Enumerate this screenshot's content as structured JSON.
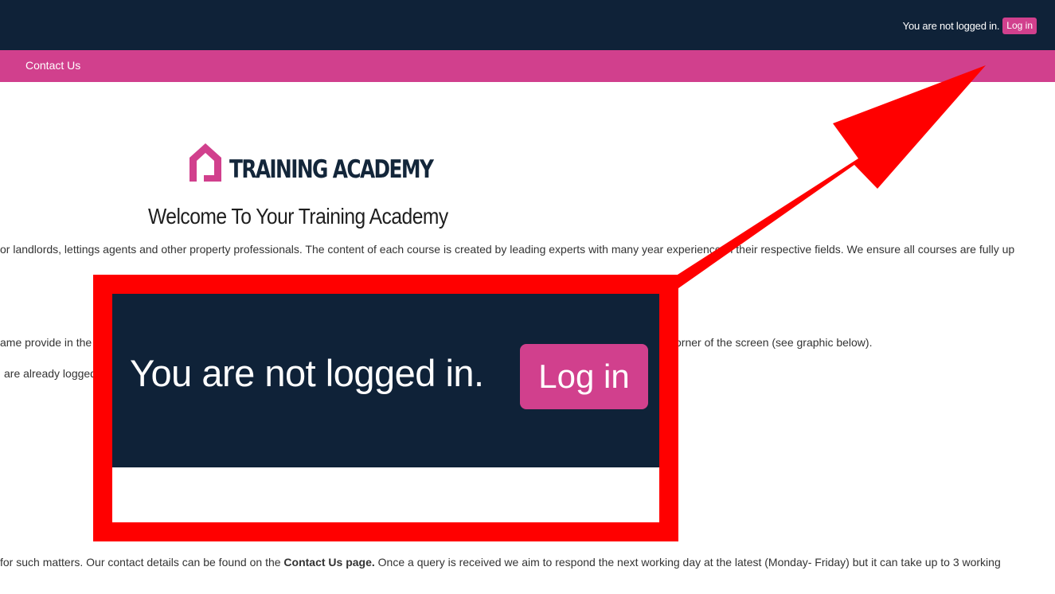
{
  "header": {
    "login_status": "You are not logged in.",
    "login_button": "Log in"
  },
  "nav": {
    "contact_us": "Contact Us"
  },
  "logo": {
    "text": "TRAINING ACADEMY"
  },
  "main": {
    "heading": "Welcome To Your Training Academy",
    "paragraph1": "or landlords, lettings agents and other property professionals. The content of each course is created by leading experts with many year experience in their respective fields. We ensure all courses are fully up",
    "paragraph2_left": "ame provide in the",
    "paragraph2_right": "orner of the screen (see graphic below).",
    "paragraph3": "are already logged",
    "paragraph4_start": "for such matters. Our contact details can be found on the ",
    "paragraph4_link": "Contact Us page.",
    "paragraph4_end": " Once a query is received we aim to respond the next working day at the latest (Monday- Friday) but it can take up to 3 working"
  },
  "callout": {
    "login_status": "You are not logged in.",
    "login_button": "Log in",
    "border_color": "#ff0000"
  },
  "colors": {
    "header_bg": "#0f2238",
    "accent": "#d1408d",
    "annotation": "#ff0000"
  }
}
